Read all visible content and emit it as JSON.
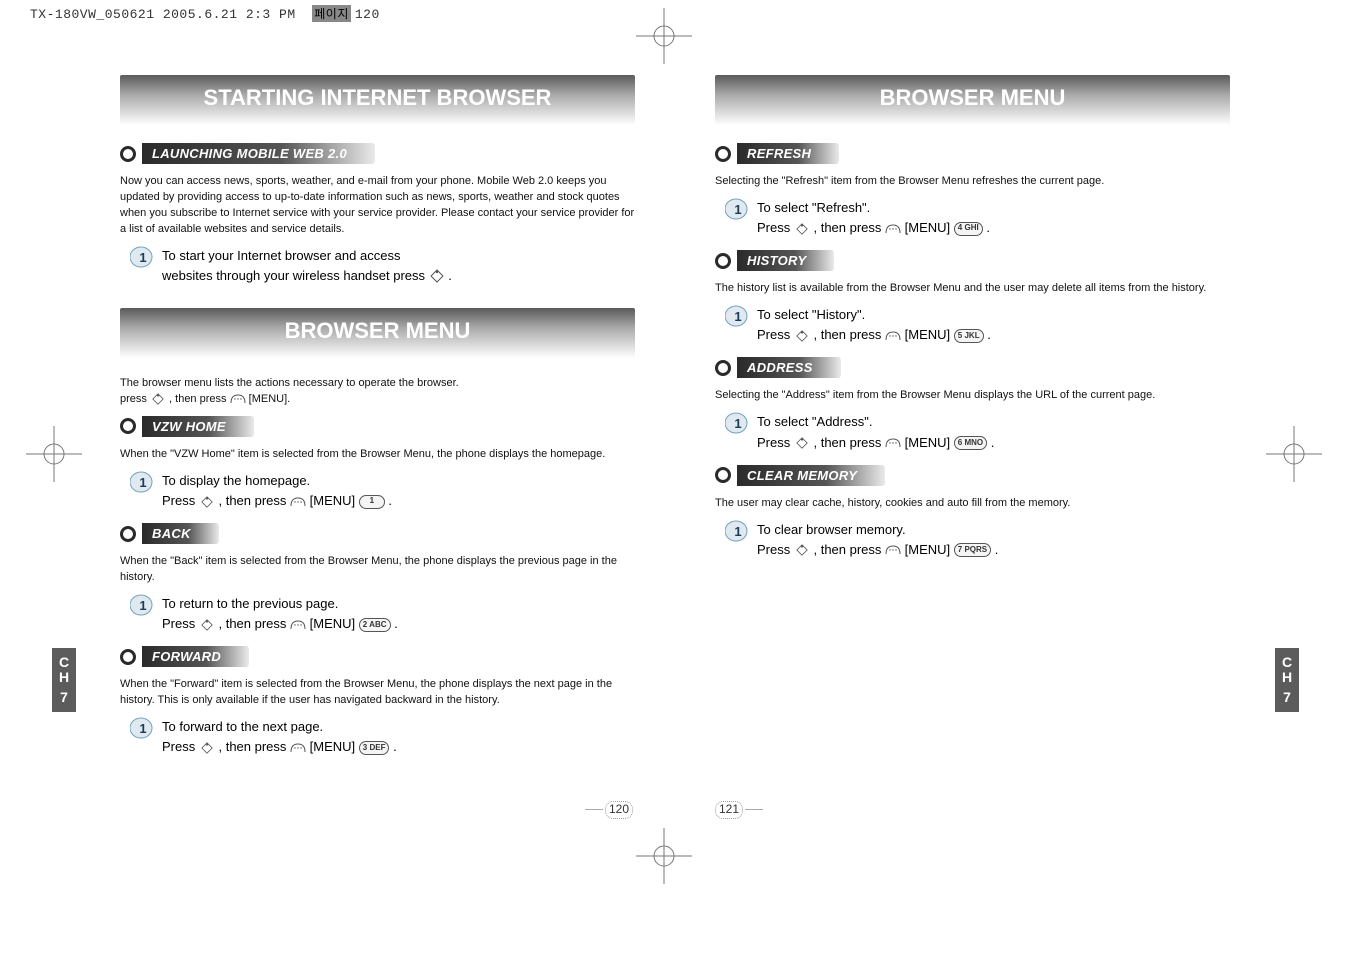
{
  "header": {
    "file_stamp": "TX-180VW_050621  2005.6.21 2:3 PM",
    "page_tag": "페이지",
    "page_tag_num": "120"
  },
  "left_page": {
    "title": "STARTING INTERNET BROWSER",
    "launching": {
      "heading": "LAUNCHING MOBILE WEB 2.0",
      "body": "Now you can access news, sports, weather, and e-mail from your phone. Mobile Web 2.0 keeps you updated by providing access to up-to-date information such as news, sports, weather and stock quotes when you subscribe to Internet service with your service provider. Please contact your service provider for a list of available websites and service details.",
      "step1_a": "To start your Internet browser and access",
      "step1_b": "websites through your wireless handset press",
      "step1_end": "."
    },
    "browser_menu_title": "BROWSER MENU",
    "browser_menu_intro_a": "The browser menu lists the actions necessary to operate the browser.",
    "browser_menu_intro_b_1": "press",
    "browser_menu_intro_b_2": ", then press",
    "browser_menu_intro_b_3": "[MENU].",
    "vzw_home": {
      "heading": "VZW HOME",
      "body": "When the \"VZW Home\" item is selected from the Browser Menu, the phone displays the homepage.",
      "step_a": "To display the homepage.",
      "step_b1": "Press",
      "step_b2": ", then press",
      "step_b3": "[MENU]",
      "key": "1",
      "key_suffix": "."
    },
    "back": {
      "heading": "BACK",
      "body": "When the \"Back\" item is selected from the Browser Menu, the phone displays the previous page in the history.",
      "step_a": "To return to the previous page.",
      "step_b1": "Press",
      "step_b2": ", then press",
      "step_b3": "[MENU]",
      "key": "2 ABC",
      "key_suffix": "."
    },
    "forward": {
      "heading": "FORWARD",
      "body": "When the \"Forward\" item is selected from the Browser Menu, the phone displays the next page in the history. This is only available if the user has navigated backward in the history.",
      "step_a": "To forward to the next page.",
      "step_b1": "Press",
      "step_b2": ", then press",
      "step_b3": "[MENU]",
      "key": "3 DEF",
      "key_suffix": "."
    },
    "page_number": "120"
  },
  "right_page": {
    "title": "BROWSER MENU",
    "refresh": {
      "heading": "REFRESH",
      "body": "Selecting the \"Refresh\" item from the Browser Menu refreshes the current page.",
      "step_a": "To select \"Refresh\".",
      "step_b1": "Press",
      "step_b2": ", then press",
      "step_b3": "[MENU]",
      "key": "4 GHI",
      "key_suffix": "."
    },
    "history": {
      "heading": "HISTORY",
      "body": "The history list is available from the Browser Menu and the user may delete all items from the history.",
      "step_a": "To select \"History\".",
      "step_b1": "Press",
      "step_b2": ", then press",
      "step_b3": "[MENU]",
      "key": "5 JKL",
      "key_suffix": "."
    },
    "address": {
      "heading": "ADDRESS",
      "body": "Selecting the \"Address\" item from the Browser Menu displays the URL of the current page.",
      "step_a": "To select \"Address\".",
      "step_b1": "Press",
      "step_b2": ", then press",
      "step_b3": "[MENU]",
      "key": "6 MNO",
      "key_suffix": "."
    },
    "clear_memory": {
      "heading": "CLEAR MEMORY",
      "body": "The user may clear cache, history, cookies and auto fill from the memory.",
      "step_a": "To clear browser memory.",
      "step_b1": "Press",
      "step_b2": ", then press",
      "step_b3": "[MENU]",
      "key": "7 PQRS",
      "key_suffix": "."
    },
    "page_number": "121"
  },
  "chapter_tab": {
    "label_line1": "C",
    "label_line2": "H",
    "number": "7"
  }
}
